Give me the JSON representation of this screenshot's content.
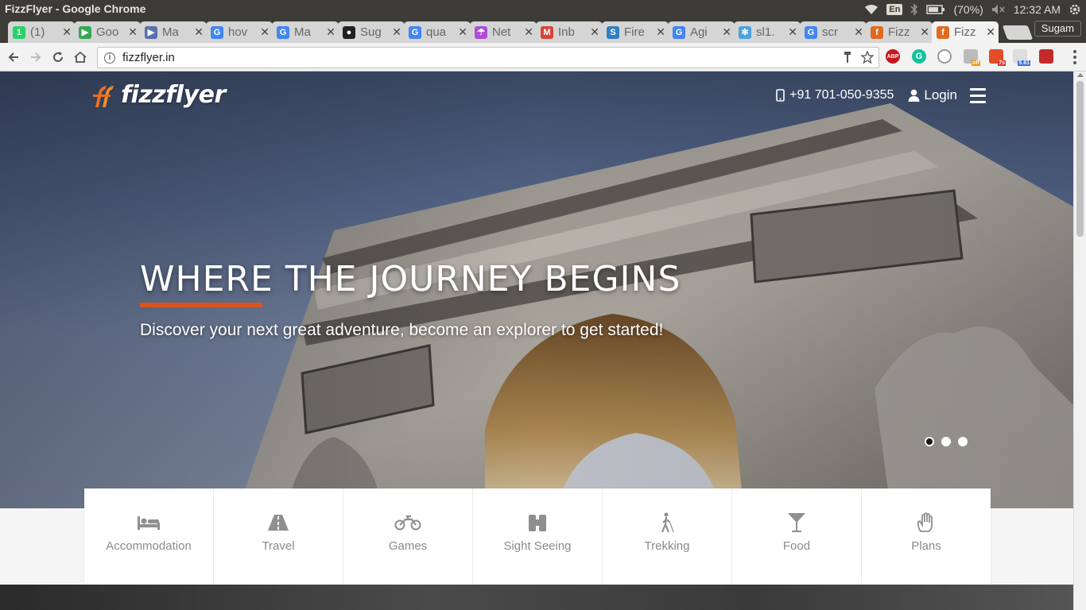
{
  "os": {
    "window_title": "FizzFlyer - Google Chrome",
    "keyboard": "En",
    "battery": "(70%)",
    "time": "12:32 AM"
  },
  "tabs": [
    {
      "label": "(1)",
      "icon": "whatsapp-icon",
      "color": "#25d366"
    },
    {
      "label": "Goo",
      "icon": "google-play-icon",
      "color": "#34a853"
    },
    {
      "label": "Ma",
      "icon": "play-store-icon",
      "color": "#5a6fb0"
    },
    {
      "label": "hov",
      "icon": "google-icon",
      "color": "#4285f4"
    },
    {
      "label": "Ma",
      "icon": "google-icon",
      "color": "#4285f4"
    },
    {
      "label": "Sug",
      "icon": "github-icon",
      "color": "#222222"
    },
    {
      "label": "qua",
      "icon": "google-icon",
      "color": "#4285f4"
    },
    {
      "label": "Net",
      "icon": "umbrella-icon",
      "color": "#b04bd6"
    },
    {
      "label": "Inb",
      "icon": "gmail-icon",
      "color": "#d44638"
    },
    {
      "label": "Fire",
      "icon": "s-icon",
      "color": "#2f7fc1"
    },
    {
      "label": "Agi",
      "icon": "google-icon",
      "color": "#4285f4"
    },
    {
      "label": "sl1.",
      "icon": "swirl-icon",
      "color": "#4aa3df"
    },
    {
      "label": "scr",
      "icon": "google-icon",
      "color": "#4285f4"
    },
    {
      "label": "Fizz",
      "icon": "fizzflyer-icon",
      "color": "#e06a1f"
    },
    {
      "label": "Fizz",
      "icon": "fizzflyer-icon",
      "color": "#e06a1f"
    }
  ],
  "profile": "Sugam",
  "address": {
    "url": "fizzflyer.in"
  },
  "site": {
    "brand": "fizzflyer",
    "phone": "+91 701-050-9355",
    "login": "Login",
    "headline": "WHERE THE JOURNEY BEGINS",
    "subline": "Discover your next great adventure, become an explorer to get started!",
    "accent": "#d9531e",
    "slides_total": 3,
    "slide_active": 1
  },
  "categories": [
    {
      "label": "Accommodation",
      "icon": "bed-icon"
    },
    {
      "label": "Travel",
      "icon": "road-icon"
    },
    {
      "label": "Games",
      "icon": "motorcycle-icon"
    },
    {
      "label": "Sight Seeing",
      "icon": "binoculars-icon"
    },
    {
      "label": "Trekking",
      "icon": "hiker-icon"
    },
    {
      "label": "Food",
      "icon": "cocktail-icon"
    },
    {
      "label": "Plans",
      "icon": "hand-icon"
    }
  ]
}
